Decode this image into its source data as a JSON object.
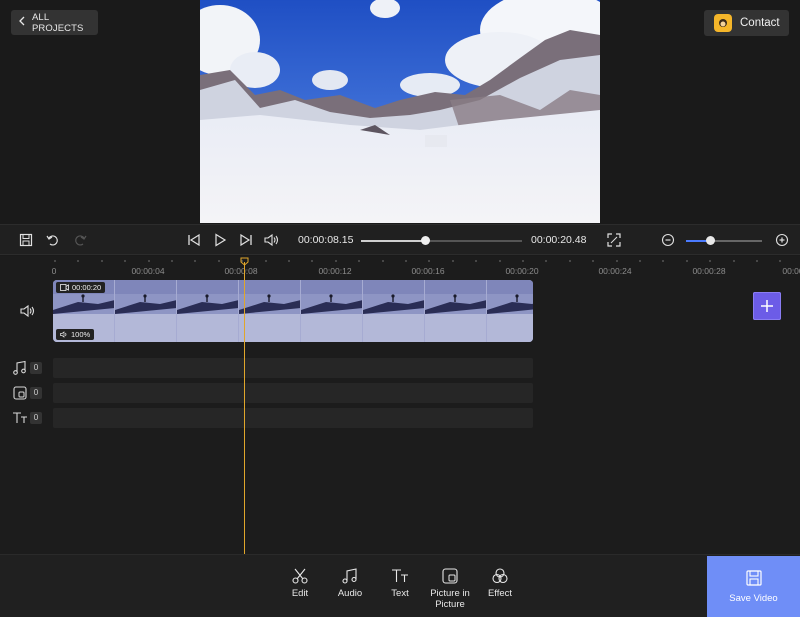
{
  "header": {
    "back_label": "ALL PROJECTS",
    "contact_label": "Contact"
  },
  "player": {
    "current_time": "00:00:08.15",
    "total_time": "00:00:20.48",
    "progress_fraction": 0.4,
    "zoom_fraction": 0.32
  },
  "ruler": {
    "ticks": [
      "0",
      "00:00:04",
      "00:00:08",
      "00:00:12",
      "00:00:16",
      "00:00:20",
      "00:00:24",
      "00:00:28",
      "00:00"
    ]
  },
  "clip": {
    "duration": "00:00:20",
    "volume": "100%"
  },
  "tracks": [
    {
      "name": "music-track",
      "icon": "music-note-icon",
      "count": "0"
    },
    {
      "name": "pip-track",
      "icon": "picture-in-picture-icon",
      "count": "0"
    },
    {
      "name": "text-track",
      "icon": "text-icon",
      "count": "0"
    }
  ],
  "toolbar": {
    "edit_label": "Edit",
    "audio_label": "Audio",
    "text_label": "Text",
    "pip_label": "Picture in Picture",
    "effect_label": "Effect",
    "save_label": "Save Video"
  },
  "colors": {
    "accent": "#6f8ef7",
    "add_button": "#6c5ce7",
    "playhead": "#e0a62b",
    "zoom_fill": "#4b7bff"
  }
}
